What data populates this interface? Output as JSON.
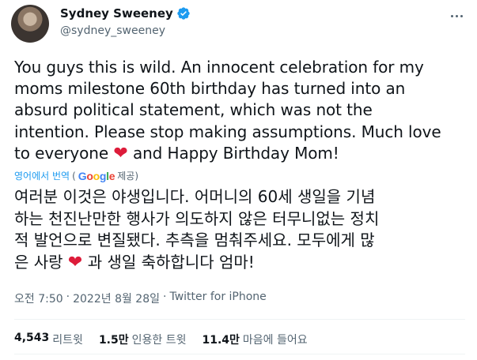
{
  "author": {
    "display_name": "Sydney Sweeney",
    "handle": "@sydney_sweeney"
  },
  "tweet": {
    "text_lines": [
      "You guys this is wild. An innocent celebration for my",
      "moms milestone 60th birthday has turned into an",
      "absurd political statement, which was not the",
      "intention. Please stop making assumptions. Much love",
      "to everyone",
      "and Happy Birthday Mom!"
    ],
    "heart": "❤"
  },
  "translation": {
    "link_label": "영어에서 번역",
    "open_paren": "(",
    "google": [
      "G",
      "o",
      "o",
      "g",
      "l",
      "e"
    ],
    "provided_label": "제공)",
    "lines": [
      "여러분 이것은 야생입니다. 어머니의 60세 생일을 기념",
      "하는 천진난만한 행사가 의도하지 않은 터무니없는 정치",
      "적 발언으로 변질됐다. 추측을 멈춰주세요. 모두에게 많",
      "은 사랑",
      "과 생일 축하합니다 엄마!"
    ]
  },
  "meta": {
    "time": "오전 7:50",
    "separator": "·",
    "date": "2022년 8월 28일",
    "source": "Twitter for iPhone"
  },
  "stats": {
    "retweets": {
      "count": "4,543",
      "label": "리트윗"
    },
    "quotes": {
      "count": "1.5만",
      "label": "인용한 트윗"
    },
    "likes": {
      "count": "11.4만",
      "label": "마음에 들어요"
    }
  },
  "colors": {
    "accent": "#1d9bf0",
    "heart": "#dd1c3a",
    "secondary_text": "#536471"
  }
}
